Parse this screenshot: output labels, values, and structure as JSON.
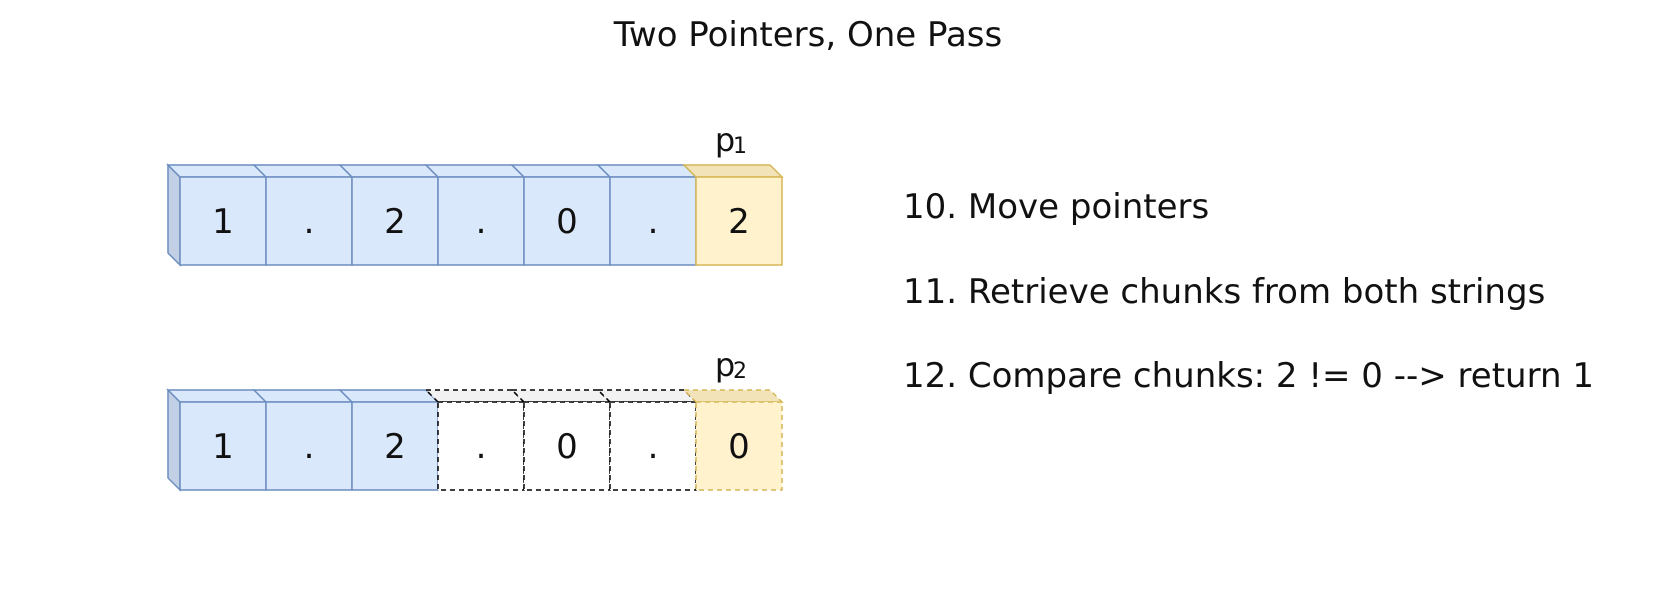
{
  "title": "Two Pointers, One Pass",
  "colors": {
    "filled_face": "#dae8fc",
    "filled_side": "#c2d0e6",
    "filled_stroke": "#6c8ebf",
    "highlight_face": "#fff2cc",
    "highlight_top": "#f2e4b8",
    "highlight_stroke": "#d6b656",
    "empty_stroke": "#000000",
    "empty_top": "#f2f2f2"
  },
  "arrays": [
    {
      "cells": [
        {
          "text": "1",
          "style": "filled"
        },
        {
          "text": ".",
          "style": "filled"
        },
        {
          "text": "2",
          "style": "filled"
        },
        {
          "text": ".",
          "style": "filled"
        },
        {
          "text": "0",
          "style": "filled"
        },
        {
          "text": ".",
          "style": "filled"
        },
        {
          "text": "2",
          "style": "highlight"
        }
      ],
      "pointer": {
        "label": "p",
        "subscript": "1",
        "index": 6
      }
    },
    {
      "cells": [
        {
          "text": "1",
          "style": "filled"
        },
        {
          "text": ".",
          "style": "filled"
        },
        {
          "text": "2",
          "style": "filled"
        },
        {
          "text": ".",
          "style": "empty"
        },
        {
          "text": "0",
          "style": "empty"
        },
        {
          "text": ".",
          "style": "empty"
        },
        {
          "text": "0",
          "style": "highlight-dashed"
        }
      ],
      "pointer": {
        "label": "p",
        "subscript": "2",
        "index": 6
      }
    }
  ],
  "steps": [
    "10. Move pointers",
    "11. Retrieve chunks from both strings",
    "12. Compare chunks: 2 != 0 --> return 1"
  ]
}
